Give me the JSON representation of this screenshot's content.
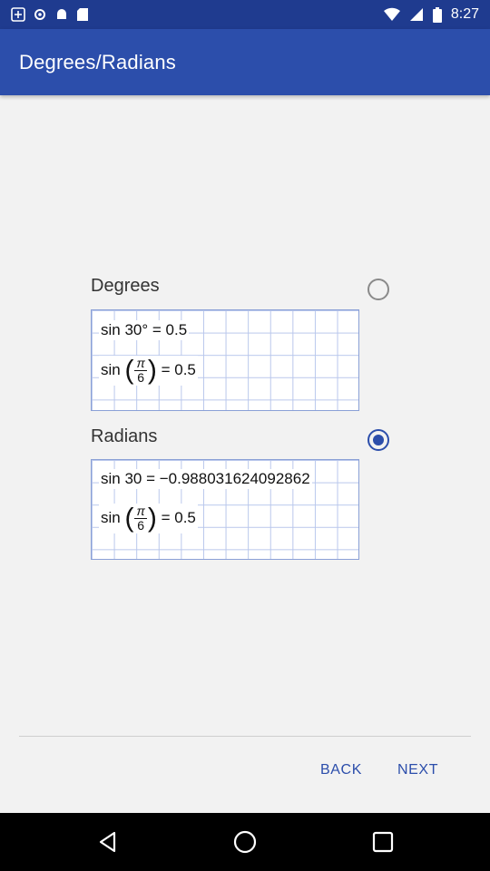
{
  "status_bar": {
    "time": "8:27",
    "icons": [
      "notification-icon",
      "settings-icon",
      "android-icon",
      "sd-card-icon",
      "wifi-icon",
      "signal-icon",
      "battery-icon"
    ]
  },
  "app_bar": {
    "title": "Degrees/Radians"
  },
  "options": [
    {
      "label": "Degrees",
      "selected": false,
      "formula_1": "sin 30° = 0.5",
      "formula_2_prefix": "sin",
      "formula_2_num": "π",
      "formula_2_den": "6",
      "formula_2_suffix": "= 0.5"
    },
    {
      "label": "Radians",
      "selected": true,
      "formula_1": "sin 30 = −0.988031624092862",
      "formula_2_prefix": "sin",
      "formula_2_num": "π",
      "formula_2_den": "6",
      "formula_2_suffix": "= 0.5"
    }
  ],
  "footer": {
    "back_label": "BACK",
    "next_label": "NEXT"
  },
  "colors": {
    "accent": "#2c4eab",
    "status_bar": "#1f3b8f"
  }
}
